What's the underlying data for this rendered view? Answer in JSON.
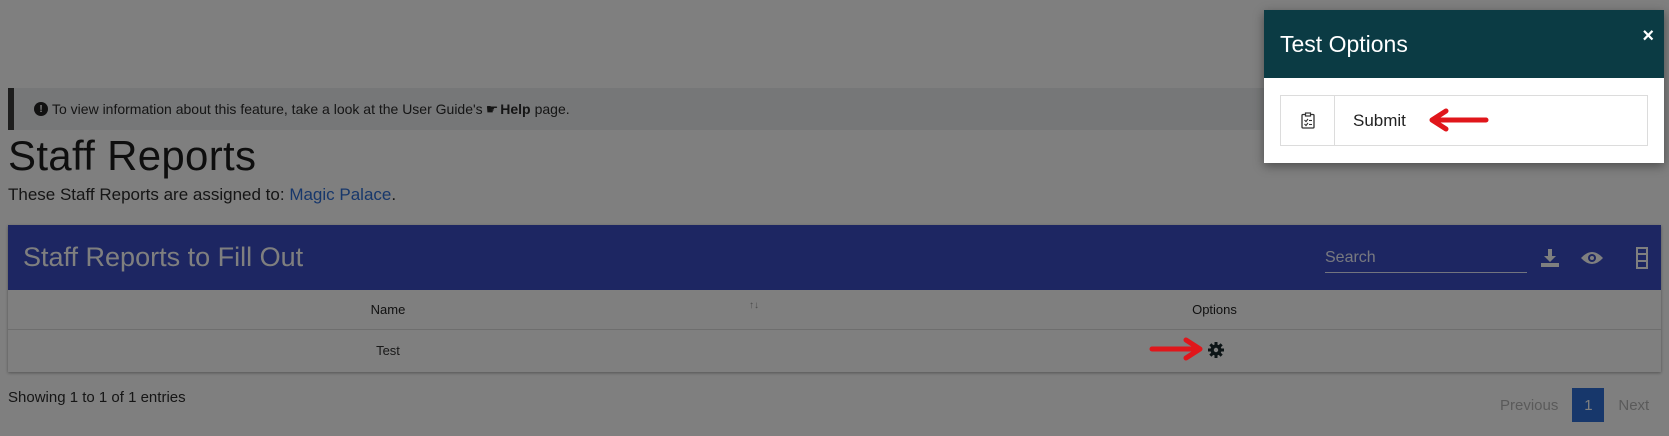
{
  "info_bar": {
    "text_before": "To view information about this feature, take a look at the User Guide's",
    "help_label": "Help",
    "text_after": "page."
  },
  "page": {
    "title": "Staff Reports",
    "assigned_prefix": "These Staff Reports are assigned to:",
    "assigned_link": "Magic Palace",
    "assigned_suffix": "."
  },
  "table": {
    "title": "Staff Reports to Fill Out",
    "search_placeholder": "Search",
    "columns": [
      "Name",
      "Options"
    ],
    "rows": [
      {
        "name": "Test"
      }
    ],
    "showing": "Showing 1 to 1 of 1 entries",
    "pagination": {
      "previous": "Previous",
      "current": "1",
      "next": "Next"
    }
  },
  "modal": {
    "title": "Test Options",
    "close_glyph": "×",
    "options": [
      {
        "label": "Submit",
        "icon": "clipboard-check-icon"
      }
    ]
  },
  "colors": {
    "panel_header": "#3a4cc4",
    "modal_header": "#0b3b44",
    "link": "#2f6fd6",
    "annotation_arrow": "#e0161b"
  }
}
